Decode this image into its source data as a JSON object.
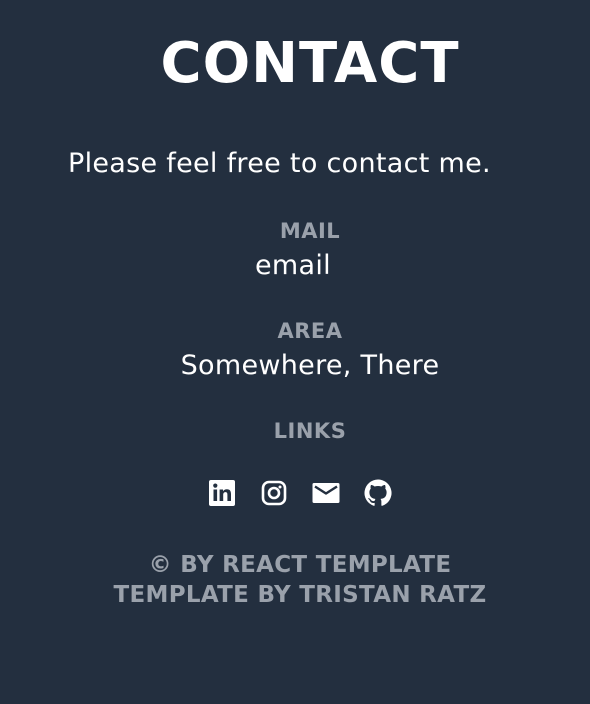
{
  "contact": {
    "title": "CONTACT",
    "intro": "Please feel free to contact me.",
    "mail": {
      "label": "MAIL",
      "value": "email"
    },
    "area": {
      "label": "AREA",
      "value": "Somewhere, There"
    },
    "links": {
      "label": "LINKS",
      "icons": [
        "linkedin-icon",
        "instagram-icon",
        "mail-icon",
        "github-icon"
      ]
    }
  },
  "footer": {
    "line1": "© BY REACT TEMPLATE",
    "line2": "TEMPLATE BY TRISTAN RATZ"
  },
  "colors": {
    "background": "#232f3f",
    "text": "#ffffff",
    "muted": "#9aa1ab"
  }
}
